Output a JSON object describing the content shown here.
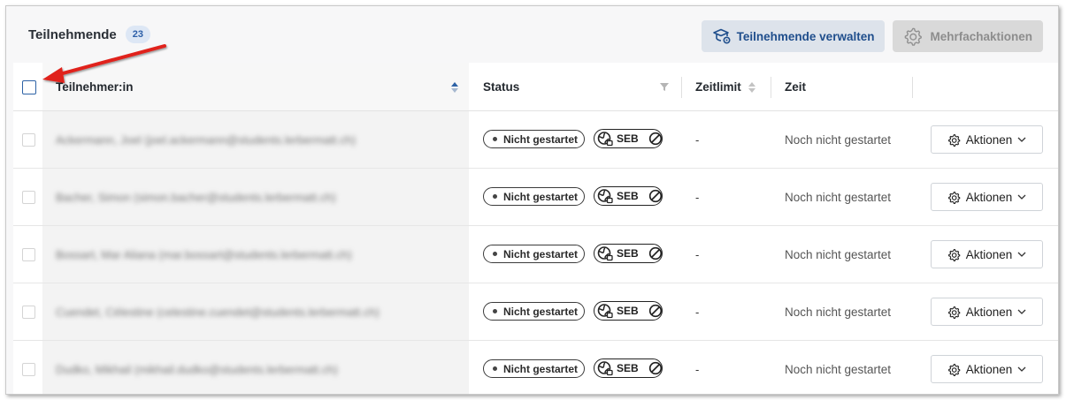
{
  "header": {
    "title": "Teilnehmende",
    "count": "23",
    "manage_label": "Teilnehmende verwalten",
    "multi_label": "Mehrfachaktionen"
  },
  "columns": {
    "participant": "Teilnehmer:in",
    "status": "Status",
    "time_limit": "Zeitlimit",
    "time": "Zeit"
  },
  "rows": [
    {
      "name": "Ackermann, Joel (joel.ackermann@students.lerbermatt.ch)",
      "status": "Nicht gestartet",
      "seb": "SEB",
      "time_limit": "-",
      "time": "Noch nicht gestartet",
      "action": "Aktionen"
    },
    {
      "name": "Bacher, Simon (simon.bacher@students.lerbermatt.ch)",
      "status": "Nicht gestartet",
      "seb": "SEB",
      "time_limit": "-",
      "time": "Noch nicht gestartet",
      "action": "Aktionen"
    },
    {
      "name": "Bossart, Mar Aliana (mar.bossart@students.lerbermatt.ch)",
      "status": "Nicht gestartet",
      "seb": "SEB",
      "time_limit": "-",
      "time": "Noch nicht gestartet",
      "action": "Aktionen"
    },
    {
      "name": "Cuendet, Célestine (celestine.cuendet@students.lerbermatt.ch)",
      "status": "Nicht gestartet",
      "seb": "SEB",
      "time_limit": "-",
      "time": "Noch nicht gestartet",
      "action": "Aktionen"
    },
    {
      "name": "Dudko, Mikhail (mikhail.dudko@students.lerbermatt.ch)",
      "status": "Nicht gestartet",
      "seb": "SEB",
      "time_limit": "-",
      "time": "Noch nicht gestartet",
      "action": "Aktionen"
    }
  ],
  "colors": {
    "accent": "#2d62a6",
    "annotation_arrow": "#e0201a"
  }
}
